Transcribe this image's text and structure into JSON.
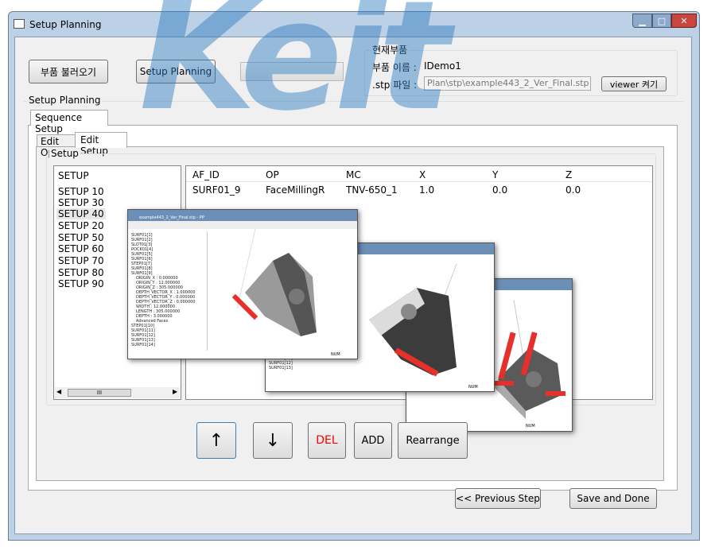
{
  "window": {
    "title": "Setup Planning",
    "controls": [
      "minimize",
      "maximize",
      "close"
    ]
  },
  "toolbar": {
    "load_part": "부품 불러오기",
    "setup_planning": "Setup Planning"
  },
  "current_part": {
    "group_label": "현재부품",
    "name_label": "부품 이름 :",
    "name_value": "IDemo1",
    "stp_label": ".stp 파일 :",
    "stp_value": "Plan\\stp\\example443_2_Ver_Final.stp",
    "viewer_button": "viewer 켜기"
  },
  "setup_planning": {
    "group_label": "Setup Planning",
    "tab": "Sequence Setup",
    "subtabs": [
      "Edit Op",
      "Edit Setup"
    ],
    "active_subtab": "Edit Setup",
    "setup_group_label": "Setup"
  },
  "setup_list": {
    "header": "SETUP",
    "items": [
      "SETUP 10",
      "SETUP 30",
      "SETUP 40",
      "SETUP 20",
      "SETUP 50",
      "SETUP 60",
      "SETUP 70",
      "SETUP 80",
      "SETUP 90"
    ],
    "selected": "SETUP 40",
    "scroll_thumb": "III"
  },
  "table": {
    "columns": [
      "AF_ID",
      "OP",
      "MC",
      "X",
      "Y",
      "Z"
    ],
    "rows": [
      [
        "SURF01_9",
        "FaceMillingR",
        "TNV-650_1",
        "1.0",
        "0.0",
        "0.0"
      ]
    ]
  },
  "actions": {
    "up": "↑",
    "down": "↓",
    "del": "DEL",
    "add": "ADD",
    "rearrange": "Rearrange",
    "del_color": "#ff0000"
  },
  "footer": {
    "previous": "<< Previous Step",
    "save": "Save and Done"
  },
  "viewer_windows": {
    "title": "example443_2_Ver_Final.stp - PP",
    "tree": [
      "SURF01[1]",
      "SURF01[2]",
      "SLOT01[3]",
      "POCK01[4]",
      "SURF01[5]",
      "SURF01[6]",
      "STEP01[7]",
      "SURF01[8]",
      "SURF01[9]",
      "ORIGIN_X : 0.000000",
      "ORIGIN_Y : 12.000000",
      "ORIGIN_Z : 305.000000",
      "DEPTH_VECTOR_X : 1.000000",
      "DEPTH_VECTOR_Y : 0.000000",
      "DEPTH_VECTOR_Z : 0.000000",
      "WIDTH : 12.000000",
      "LENGTH : 305.000000",
      "DEPTH : 3.000000",
      "Advanced Faces",
      "STEP01[10]",
      "SURF01[11]",
      "SURF01[12]",
      "SURF01[13]",
      "SURF01[14]"
    ],
    "status": "NUM",
    "highlight_color": "#e8302a"
  },
  "watermark": {
    "logo": "Keit",
    "text": "KEIT KEIT KEIT"
  }
}
